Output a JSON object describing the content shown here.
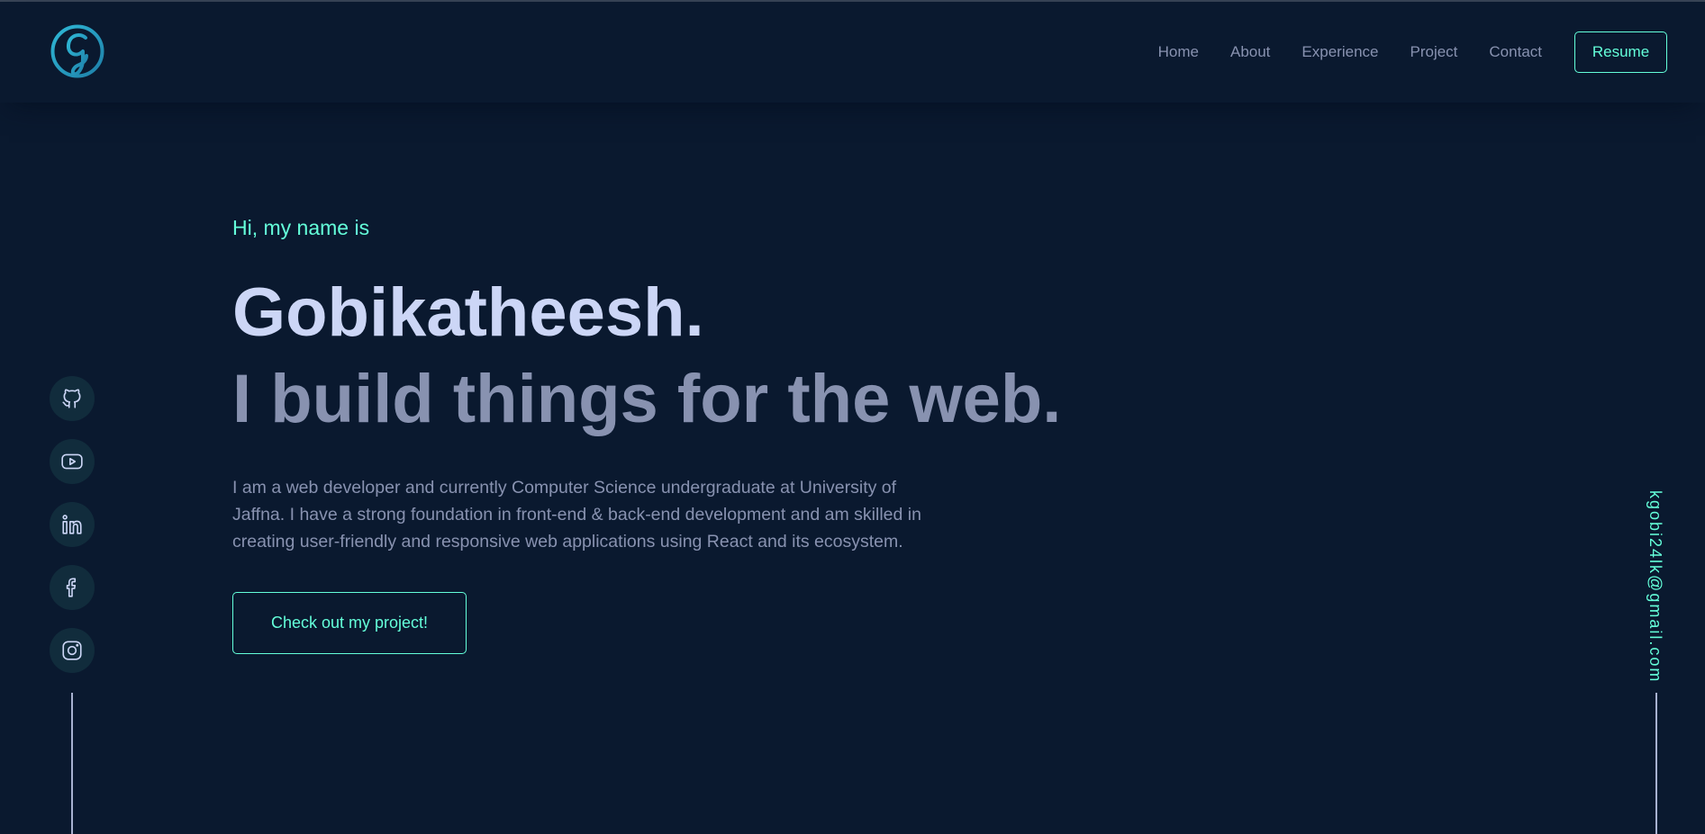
{
  "header": {
    "logo_icon": "g-monogram-logo-icon",
    "nav": [
      {
        "label": "Home"
      },
      {
        "label": "About"
      },
      {
        "label": "Experience"
      },
      {
        "label": "Project"
      },
      {
        "label": "Contact"
      }
    ],
    "resume_label": "Resume"
  },
  "hero": {
    "greeting": "Hi, my name is",
    "name": "Gobikatheesh.",
    "tagline": "I build things for the web.",
    "bio": "I am a web developer and currently Computer Science undergraduate at University of Jaffna. I have a strong foundation in front-end & back-end development and am skilled in creating user-friendly and responsive web applications using React and its ecosystem.",
    "cta_label": "Check out my project!"
  },
  "social": [
    {
      "icon": "github-icon"
    },
    {
      "icon": "youtube-icon"
    },
    {
      "icon": "linkedin-icon"
    },
    {
      "icon": "facebook-icon"
    },
    {
      "icon": "instagram-icon"
    }
  ],
  "email": "kgobi24lk@gmail.com",
  "colors": {
    "background": "#0a192f",
    "accent": "#64ffda",
    "heading": "#ccd6f6",
    "muted": "#8892b0",
    "social_bg": "#112c3c"
  }
}
